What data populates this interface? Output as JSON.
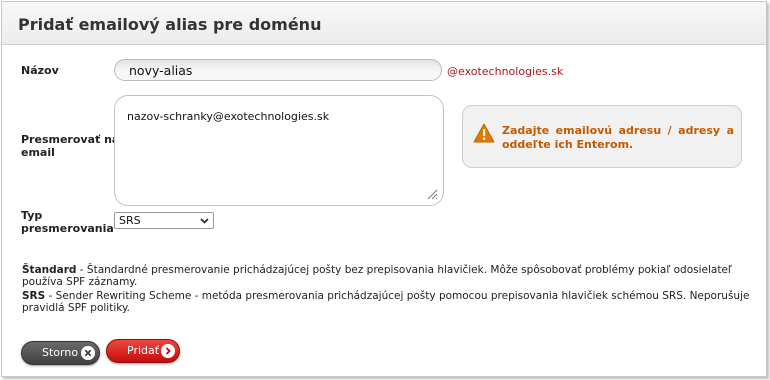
{
  "dialog": {
    "title": "Pridať emailový alias pre doménu"
  },
  "form": {
    "name_label": "Názov",
    "name_value": "novy-alias",
    "domain_suffix": "@exotechnologies.sk",
    "redirect_label_line1": "Presmerovať na",
    "redirect_label_line2": "email",
    "redirect_value": "nazov-schranky@exotechnologies.sk",
    "type_label_line1": "Typ",
    "type_label_line2": "presmerovania",
    "type_value": "SRS"
  },
  "hint": {
    "icon": "warning-icon",
    "text": "Zadajte emailovú adresu / adresy a oddeľte ich Enterom."
  },
  "info": {
    "standard_term": "Štandard",
    "standard_desc": " - Štandardné presmerovanie prichádzajúcej pošty bez prepisovania hlavičiek. Môže spôsobovať problémy pokiaľ odosielateľ používa SPF záznamy.",
    "srs_term": "SRS",
    "srs_desc": " - Sender Rewriting Scheme - metóda presmerovania prichádzajúcej pošty pomocou prepisovania hlavičiek schémou SRS. Neporušuje pravidlá SPF politiky."
  },
  "buttons": {
    "cancel_label": "Storno",
    "add_label": "Pridať"
  },
  "colors": {
    "accent_red": "#d51a17",
    "hint_text": "#c35a00",
    "domain_text": "#a21a1a"
  }
}
